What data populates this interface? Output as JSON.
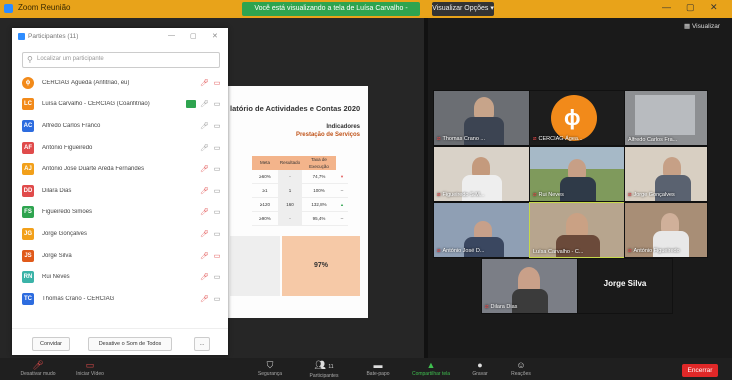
{
  "window": {
    "title": "Zoom Reunião",
    "share_banner": "Você está visualizando a tela de Luísa Carvalho - CERCIAG",
    "view_options": "Visualizar Opções",
    "view_mode": "Visualizar"
  },
  "participants_panel": {
    "title": "Participantes (11)",
    "search_placeholder": "Localizar um participante",
    "participants": [
      {
        "initials": "",
        "name": "CERCIAG Águeda (Anfitrião, eu)",
        "color": "#f28a1a"
      },
      {
        "initials": "LC",
        "name": "Luísa Carvalho - CERCIAG (Coanfitrião)",
        "color": "#f28a1a"
      },
      {
        "initials": "AC",
        "name": "Alfredo Carlos Franco",
        "color": "#2d6cdf"
      },
      {
        "initials": "AF",
        "name": "António Figueiredo",
        "color": "#e04b4b"
      },
      {
        "initials": "AJ",
        "name": "António José Duarte Areda Fernandes",
        "color": "#f2a01a"
      },
      {
        "initials": "DD",
        "name": "Dilara Dias",
        "color": "#e04b4b"
      },
      {
        "initials": "FS",
        "name": "Figueiredo Simões",
        "color": "#2ea44f"
      },
      {
        "initials": "JG",
        "name": "Jorge Gonçalves",
        "color": "#f2a01a"
      },
      {
        "initials": "JS",
        "name": "Jorge Silva",
        "color": "#e05a1a"
      },
      {
        "initials": "RN",
        "name": "Rui Neves",
        "color": "#3bb3a8"
      },
      {
        "initials": "TC",
        "name": "Thomas Crano - CERCIAG",
        "color": "#2d6cdf"
      }
    ],
    "footer": {
      "invite": "Convidar",
      "mute_all": "Desative o Som de Todos",
      "more": "..."
    }
  },
  "shared_doc": {
    "title": "latório de Actividades e Contas 2020",
    "indicators": "Indicadores",
    "subtitle": "Prestação de Serviços",
    "headers": [
      "Meta",
      "Resultado",
      "Taxa de Execução"
    ],
    "rows": [
      [
        "≥60%",
        "-",
        "74,7%",
        "▾"
      ],
      [
        "≥1",
        "1",
        "100%",
        "–"
      ],
      [
        "≥120",
        "160",
        "132,8%",
        "▴"
      ],
      [
        "≥90%",
        "-",
        "95,4%",
        "–"
      ]
    ],
    "summary_value": "97%"
  },
  "gallery": {
    "tiles": [
      {
        "name": "Thomas Crano ..."
      },
      {
        "name": "CERCIAG Ágea..."
      },
      {
        "name": "Alfredo Carlos Fra..."
      },
      {
        "name": "Figueiredo S.M..."
      },
      {
        "name": "Rui Neves"
      },
      {
        "name": "Jorge Gonçalves"
      },
      {
        "name": "António José D..."
      },
      {
        "name": "Luísa Carvalho - C..."
      },
      {
        "name": "António Figueiredo"
      },
      {
        "name": "Dilara Dias"
      },
      {
        "name": "Jorge Silva"
      }
    ]
  },
  "toolbar": {
    "items": [
      {
        "icon": "mic-icon",
        "label": "Desativar mudo"
      },
      {
        "icon": "video-icon",
        "label": "Iniciar Vídeo"
      },
      {
        "icon": "shield-icon",
        "label": "Segurança"
      },
      {
        "icon": "participants-icon",
        "label": "Participantes",
        "count": "11"
      },
      {
        "icon": "chat-icon",
        "label": "Bate-papo"
      },
      {
        "icon": "share-icon",
        "label": "Compartilhar tela"
      },
      {
        "icon": "record-icon",
        "label": "Gravar"
      },
      {
        "icon": "reactions-icon",
        "label": "Reações"
      }
    ],
    "end_label": "Encerrar"
  }
}
